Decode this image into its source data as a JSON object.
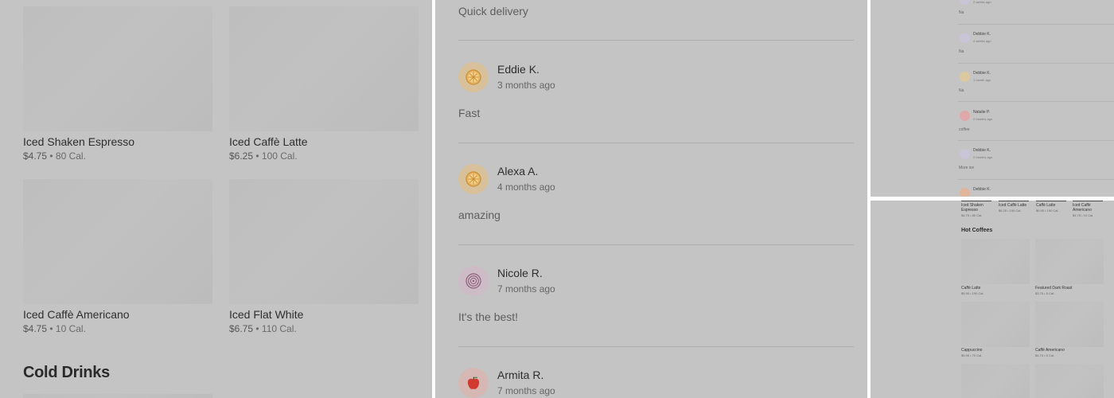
{
  "menu": {
    "items": [
      {
        "name": "Iced Shaken Espresso",
        "price": "$4.75",
        "cal": "80 Cal."
      },
      {
        "name": "Iced Caffè Latte",
        "price": "$6.25",
        "cal": "100 Cal."
      },
      {
        "name": "Iced Caffè Americano",
        "price": "$4.75",
        "cal": "10 Cal."
      },
      {
        "name": "Iced Flat White",
        "price": "$6.75",
        "cal": "110 Cal."
      }
    ],
    "section_title": "Cold Drinks",
    "separator": " • "
  },
  "reviews": {
    "top_text": "Quick delivery",
    "items": [
      {
        "name": "Eddie K.",
        "time": "3 months ago",
        "text": "Fast",
        "icon": "orange-slice-icon",
        "color": "#d7c09a"
      },
      {
        "name": "Alexa A.",
        "time": "4 months ago",
        "text": "amazing",
        "icon": "orange-slice-icon",
        "color": "#d7c09a"
      },
      {
        "name": "Nicole R.",
        "time": "7 months ago",
        "text": "It's the best!",
        "icon": "onion-icon",
        "color": "#cdbcc6"
      },
      {
        "name": "Armita R.",
        "time": "7 months ago",
        "text": "",
        "icon": "apple-icon",
        "color": "#d6b7b3"
      }
    ]
  },
  "mini_reviews": {
    "top_time": "2 weeks ago",
    "top_text": "Na",
    "items": [
      {
        "name": "Debbie K.",
        "time": "4 weeks ago",
        "text": "Na",
        "color": "#c9c4d6"
      },
      {
        "name": "Debbie K.",
        "time": "1 month ago",
        "text": "Na",
        "color": "#dcc9a0"
      },
      {
        "name": "Natalie P.",
        "time": "2 months ago",
        "text": "coffee",
        "color": "#e0a8a8"
      },
      {
        "name": "Debbie K.",
        "time": "2 months ago",
        "text": "More ice",
        "color": "#c9c4d6"
      },
      {
        "name": "Debbie K.",
        "time": "2 months ago",
        "text": "",
        "color": "#e0b59b"
      }
    ]
  },
  "mini_menu": {
    "top_items": [
      {
        "name": "Iced Shaken Espresso",
        "meta": "$4.75 • 80 Cal."
      },
      {
        "name": "Iced Caffè Latte",
        "meta": "$6.25 • 100 Cal."
      },
      {
        "name": "Caffè Latte",
        "meta": "$5.95 • 190 Cal."
      },
      {
        "name": "Iced Caffè Americano",
        "meta": "$4.75 • 10 Cal."
      }
    ],
    "section_title": "Hot Coffees",
    "items": [
      {
        "name": "Caffè Latte",
        "meta": "$5.95 • 190 Cal."
      },
      {
        "name": "Featured Dark Roast",
        "meta": "$3.75 • 5 Cal."
      },
      {
        "name": "Cappuccino",
        "meta": "$5.95 • 70 Cal."
      },
      {
        "name": "Caffè Americano",
        "meta": "$4.75 • 5 Cal."
      }
    ]
  }
}
